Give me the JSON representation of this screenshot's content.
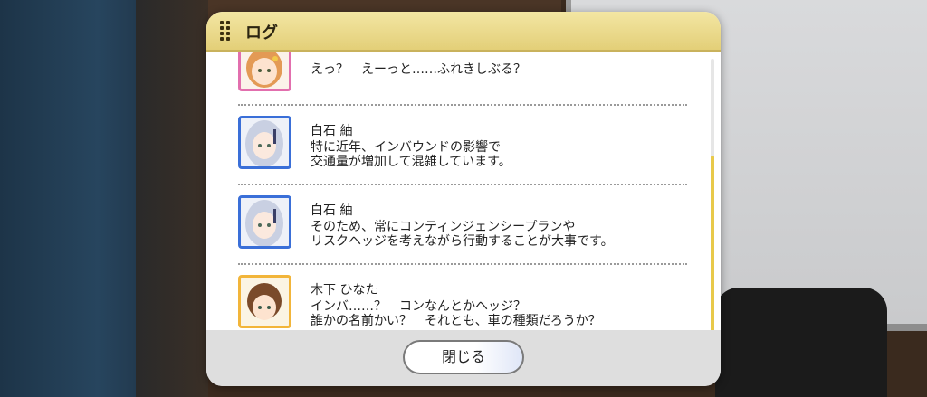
{
  "dialog": {
    "title": "ログ",
    "close_label": "閉じる"
  },
  "log": [
    {
      "speaker": "",
      "lines": [
        "えっ？　えーっと……ふれきしぶる？"
      ],
      "frame_color": "#e26fae"
    },
    {
      "speaker": "白石 紬",
      "lines": [
        "特に近年、インバウンドの影響で",
        "交通量が増加して混雑しています。"
      ],
      "frame_color": "#3a6fd8"
    },
    {
      "speaker": "白石 紬",
      "lines": [
        "そのため、常にコンティンジェンシープランや",
        "リスクヘッジを考えながら行動することが大事です。"
      ],
      "frame_color": "#3a6fd8"
    },
    {
      "speaker": "木下 ひなた",
      "lines": [
        "インバ……？　コンなんとかヘッジ？",
        "誰かの名前かい？　それとも、車の種類だろうか？"
      ],
      "frame_color": "#f2b53a"
    }
  ],
  "icons": {
    "drag_handle": "grip-dots-icon"
  },
  "colors": {
    "header": "#e8d485",
    "accent_scroll": "#e8c94a"
  }
}
